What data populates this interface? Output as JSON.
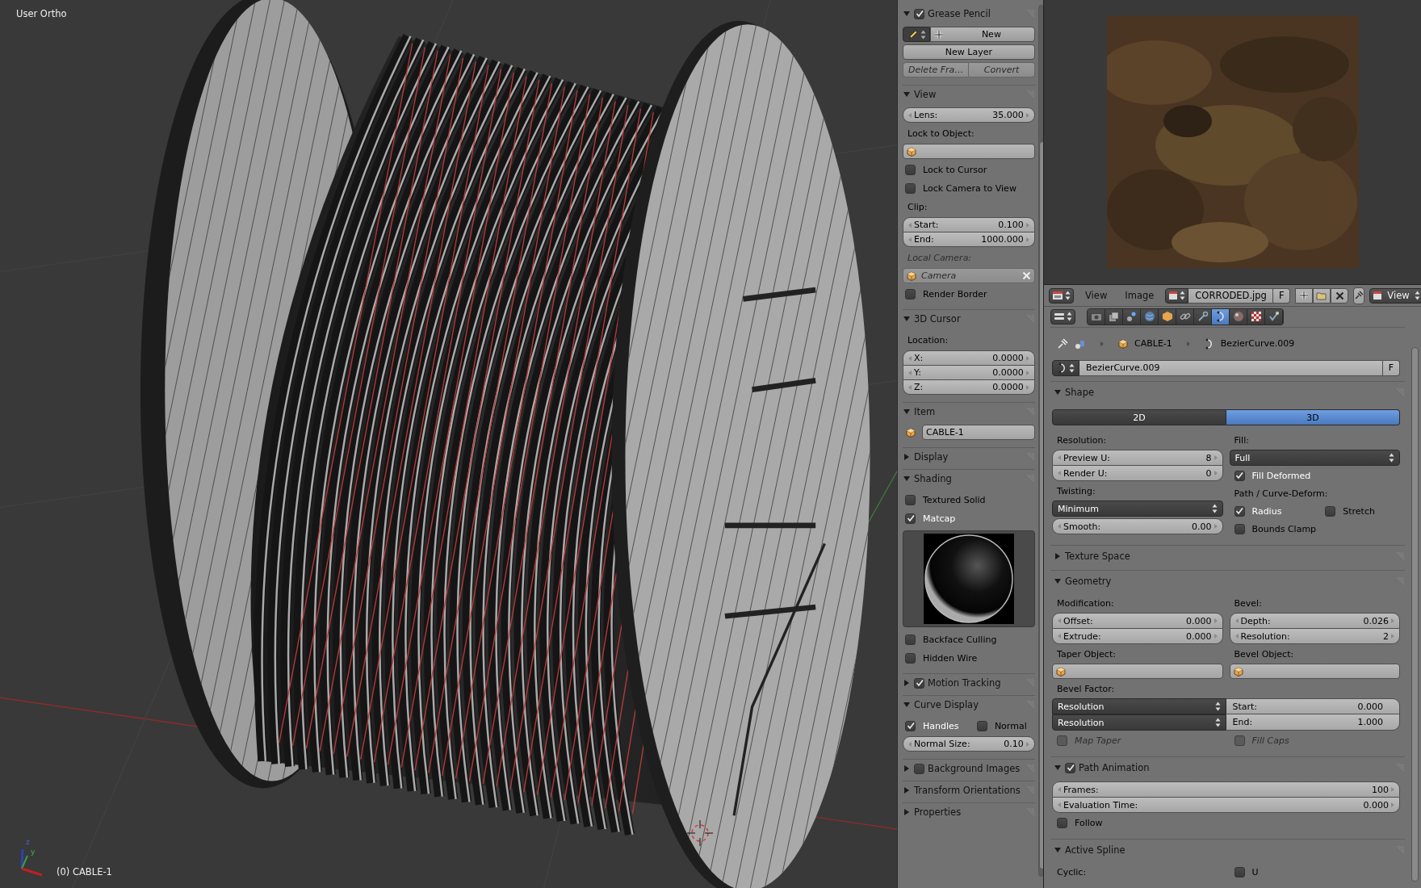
{
  "viewport": {
    "view_name": "User Ortho",
    "object_label": "(0) CABLE-1",
    "axis_labels": [
      "z",
      "y"
    ]
  },
  "npanel": {
    "panels": [
      {
        "title": "Grease Pencil",
        "expanded": true,
        "checked": true,
        "items": [
          {
            "kind": "new_row",
            "label": "New"
          },
          {
            "kind": "button",
            "label": "New Layer",
            "disabled": false
          },
          {
            "kind": "button_pair",
            "buttons": [
              {
                "label": "Delete Fra…",
                "disabled": true
              },
              {
                "label": "Convert",
                "disabled": true
              }
            ]
          }
        ]
      },
      {
        "title": "View",
        "expanded": true,
        "items": [
          {
            "kind": "numbers",
            "fields": [
              {
                "label": "Lens:",
                "value": "35.000"
              }
            ]
          },
          {
            "kind": "label",
            "text": "Lock to Object:",
            "disabled": false
          },
          {
            "kind": "object_field",
            "disabled": false
          },
          {
            "kind": "checkbox",
            "label": "Lock to Cursor",
            "checked": false,
            "disabled": false
          },
          {
            "kind": "checkbox",
            "label": "Lock Camera to View",
            "checked": false,
            "disabled": false
          },
          {
            "kind": "label",
            "text": "Clip:",
            "disabled": false
          },
          {
            "kind": "numbers",
            "fields": [
              {
                "label": "Start:",
                "value": "0.100"
              },
              {
                "label": "End:",
                "value": "1000.000"
              }
            ]
          },
          {
            "kind": "label",
            "text": "Local Camera:",
            "disabled": true
          },
          {
            "kind": "object_field",
            "value": "Camera",
            "disabled": true,
            "clearable": true
          },
          {
            "kind": "checkbox",
            "label": "Render Border",
            "checked": false,
            "disabled": false
          }
        ]
      },
      {
        "title": "3D Cursor",
        "expanded": true,
        "items": [
          {
            "kind": "label",
            "text": "Location:",
            "disabled": false
          },
          {
            "kind": "numbers",
            "fields": [
              {
                "label": "X:",
                "value": "0.0000"
              },
              {
                "label": "Y:",
                "value": "0.0000"
              },
              {
                "label": "Z:",
                "value": "0.0000"
              }
            ]
          }
        ]
      },
      {
        "title": "Item",
        "expanded": true,
        "items": [
          {
            "kind": "name_field",
            "value": "CABLE-1"
          }
        ]
      },
      {
        "title": "Display",
        "expanded": false
      },
      {
        "title": "Shading",
        "expanded": true,
        "items": [
          {
            "kind": "checkbox",
            "label": "Textured Solid",
            "checked": false,
            "disabled": false
          },
          {
            "kind": "checkbox",
            "label": "Matcap",
            "checked": true,
            "disabled": false
          },
          {
            "kind": "matcap"
          },
          {
            "kind": "checkbox",
            "label": "Backface Culling",
            "checked": false,
            "disabled": false
          },
          {
            "kind": "checkbox",
            "label": "Hidden Wire",
            "checked": false,
            "disabled": false
          }
        ]
      },
      {
        "title": "Motion Tracking",
        "expanded": false,
        "checked": true
      },
      {
        "title": "Curve Display",
        "expanded": true,
        "items": [
          {
            "kind": "checkbox_pair",
            "boxes": [
              {
                "label": "Handles",
                "checked": true,
                "disabled": false
              },
              {
                "label": "Normal",
                "checked": false,
                "disabled": false
              }
            ]
          },
          {
            "kind": "numbers",
            "fields": [
              {
                "label": "Normal Size:",
                "value": "0.10"
              }
            ]
          }
        ]
      },
      {
        "title": "Background Images",
        "expanded": false,
        "checked": false
      },
      {
        "title": "Transform Orientations",
        "expanded": false
      },
      {
        "title": "Properties",
        "expanded": false
      }
    ]
  },
  "image_header": {
    "menus": [
      "View",
      "Image"
    ],
    "image": {
      "value": "CORRODED.jpg",
      "fake_user": "F"
    },
    "mode": "View"
  },
  "properties": {
    "tabs": [
      {
        "kind": "camera",
        "selected": false
      },
      {
        "kind": "layers",
        "selected": false
      },
      {
        "kind": "scene",
        "selected": false
      },
      {
        "kind": "world",
        "selected": false
      },
      {
        "kind": "object",
        "selected": false
      },
      {
        "kind": "link",
        "selected": false
      },
      {
        "kind": "wrench",
        "selected": false
      },
      {
        "kind": "curve",
        "selected": true
      },
      {
        "kind": "material",
        "selected": false
      },
      {
        "kind": "texture",
        "selected": false
      },
      {
        "kind": "physics",
        "selected": false
      }
    ],
    "breadcrumb": [
      {
        "kind": "object",
        "text": "CABLE-1"
      },
      {
        "kind": "curve",
        "text": "BezierCurve.009"
      }
    ],
    "datablock": {
      "value": "BezierCurve.009",
      "fake_user": "F"
    },
    "panels": [
      {
        "title": "Shape",
        "expanded": true,
        "items": [
          {
            "kind": "toggle",
            "options": [
              {
                "label": "2D",
                "selected": false
              },
              {
                "label": "3D",
                "selected": true
              }
            ]
          },
          {
            "kind": "columns",
            "columns": [
              [
                {
                  "kind": "label",
                  "text": "Resolution:",
                  "disabled": false
                },
                {
                  "kind": "numbers",
                  "fields": [
                    {
                      "label": "Preview U:",
                      "value": "8"
                    },
                    {
                      "label": "Render U:",
                      "value": "0"
                    }
                  ]
                },
                {
                  "kind": "label",
                  "text": "Twisting:",
                  "disabled": false
                },
                {
                  "kind": "dropdown",
                  "value": "Minimum"
                },
                {
                  "kind": "numbers",
                  "fields": [
                    {
                      "label": "Smooth:",
                      "value": "0.00"
                    }
                  ]
                }
              ],
              [
                {
                  "kind": "label",
                  "text": "Fill:",
                  "disabled": false
                },
                {
                  "kind": "dropdown",
                  "value": "Full"
                },
                {
                  "kind": "checkbox",
                  "label": "Fill Deformed",
                  "checked": true,
                  "disabled": false
                },
                {
                  "kind": "label",
                  "text": "Path / Curve-Deform:",
                  "disabled": false
                },
                {
                  "kind": "checkbox_pair",
                  "boxes": [
                    {
                      "label": "Radius",
                      "checked": true,
                      "disabled": false
                    },
                    {
                      "label": "Stretch",
                      "checked": false,
                      "disabled": false
                    }
                  ]
                },
                {
                  "kind": "checkbox",
                  "label": "Bounds Clamp",
                  "checked": false,
                  "disabled": false
                }
              ]
            ]
          }
        ]
      },
      {
        "title": "Texture Space",
        "expanded": false
      },
      {
        "title": "Geometry",
        "expanded": true,
        "items": [
          {
            "kind": "columns",
            "columns": [
              [
                {
                  "kind": "label",
                  "text": "Modification:",
                  "disabled": false
                },
                {
                  "kind": "numbers",
                  "fields": [
                    {
                      "label": "Offset:",
                      "value": "0.000"
                    },
                    {
                      "label": "Extrude:",
                      "value": "0.000"
                    }
                  ]
                },
                {
                  "kind": "label",
                  "text": "Taper Object:",
                  "disabled": false
                },
                {
                  "kind": "object_field",
                  "disabled": false
                }
              ],
              [
                {
                  "kind": "label",
                  "text": "Bevel:",
                  "disabled": false
                },
                {
                  "kind": "numbers",
                  "fields": [
                    {
                      "label": "Depth:",
                      "value": "0.026"
                    },
                    {
                      "label": "Resolution:",
                      "value": "2"
                    }
                  ]
                },
                {
                  "kind": "label",
                  "text": "Bevel Object:",
                  "disabled": false
                },
                {
                  "kind": "object_field",
                  "disabled": false
                }
              ]
            ]
          },
          {
            "kind": "label",
            "text": "Bevel Factor:",
            "disabled": false
          },
          {
            "kind": "factor_rows",
            "rows": [
              {
                "mode": "Resolution",
                "label": "Start:",
                "value": "0.000"
              },
              {
                "mode": "Resolution",
                "label": "End:",
                "value": "1.000"
              }
            ]
          },
          {
            "kind": "columns",
            "columns": [
              [
                {
                  "kind": "checkbox",
                  "label": "Map Taper",
                  "checked": false,
                  "disabled": true
                }
              ],
              [
                {
                  "kind": "checkbox",
                  "label": "Fill Caps",
                  "checked": false,
                  "disabled": true
                }
              ]
            ]
          }
        ]
      },
      {
        "title": "Path Animation",
        "expanded": true,
        "checked": true,
        "items": [
          {
            "kind": "numbers",
            "fields": [
              {
                "label": "Frames:",
                "value": "100"
              },
              {
                "label": "Evaluation Time:",
                "value": "0.000"
              }
            ]
          },
          {
            "kind": "checkbox",
            "label": "Follow",
            "checked": false,
            "disabled": false
          }
        ]
      },
      {
        "title": "Active Spline",
        "expanded": true,
        "items": [
          {
            "kind": "columns",
            "columns": [
              [
                {
                  "kind": "label",
                  "text": "Cyclic:",
                  "disabled": false
                }
              ],
              [
                {
                  "kind": "checkbox",
                  "label": "U",
                  "checked": false,
                  "disabled": false
                }
              ]
            ]
          }
        ]
      }
    ]
  }
}
